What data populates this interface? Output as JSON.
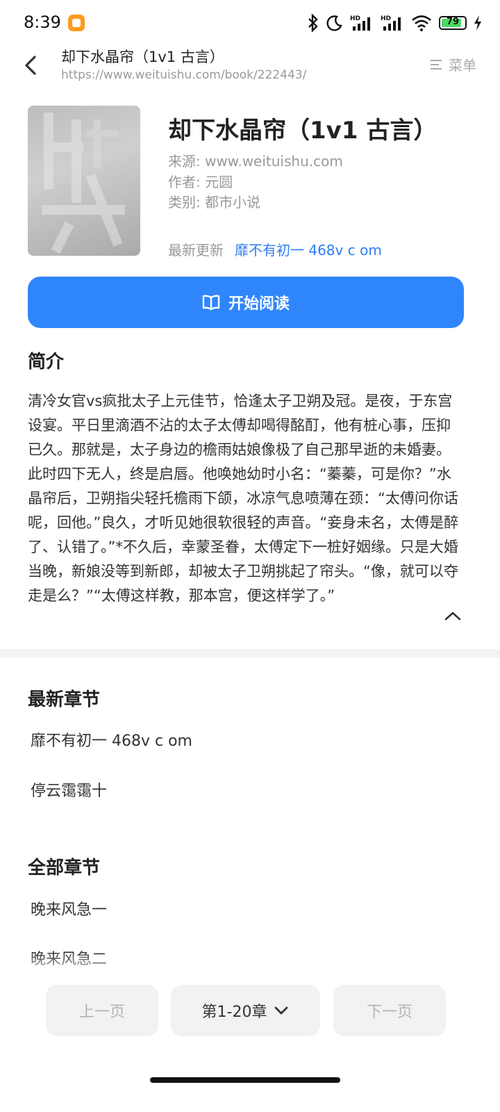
{
  "status_bar": {
    "time": "8:39",
    "battery": "79",
    "icons": [
      "bluetooth-icon",
      "moon-icon",
      "signal-hd-icon",
      "signal-hd-icon",
      "wifi-icon",
      "battery-icon",
      "charging-icon"
    ]
  },
  "header": {
    "title": "却下水晶帘（1v1 古言）",
    "url": "https://www.weituishu.com/book/222443/",
    "menu_label": "菜单"
  },
  "book": {
    "title": "却下水晶帘（1v1 古言）",
    "source": "来源: www.weituishu.com",
    "author": "作者: 元圆",
    "category": "类别: 都市小说",
    "latest_label": "最新更新",
    "latest_chapter": "靡不有初一 468v c om"
  },
  "start_button": "开始阅读",
  "synopsis": {
    "heading": "简介",
    "text": "清冷女官vs疯批太子上元佳节，恰逢太子卫朔及冠。是夜，于东宫设宴。平日里滴酒不沾的太子太傅却喝得酩酊，他有桩心事，压抑已久。那就是，太子身边的檐雨姑娘像极了自己那早逝的未婚妻。此时四下无人，终是启唇。他唤她幼时小名：“蓁蓁，可是你？”水晶帘后，卫朔指尖轻托檐雨下颌，冰凉气息喷薄在颈：“太傅问你话呢，回他。”良久，才听见她很软很轻的声音。“妾身未名，太傅是醉了、认错了。”*不久后，幸蒙圣眷，太傅定下一桩好姻缘。只是大婚当晚，新娘没等到新郎，却被太子卫朔挑起了帘头。“像，就可以夺走是么？”“太傅这样教，那本宫，便这样学了。”"
  },
  "latest_chapters": {
    "heading": "最新章节",
    "items": [
      "靡不有初一 468v c om",
      "停云霭霭十"
    ]
  },
  "all_chapters": {
    "heading": "全部章节",
    "items": [
      "晚来风急一",
      "晚来风急二"
    ]
  },
  "pager": {
    "prev": "上一页",
    "current": "第1-20章",
    "next": "下一页"
  },
  "colors": {
    "accent": "#2f86fb",
    "link": "#2f7cf6",
    "muted": "#999999"
  }
}
